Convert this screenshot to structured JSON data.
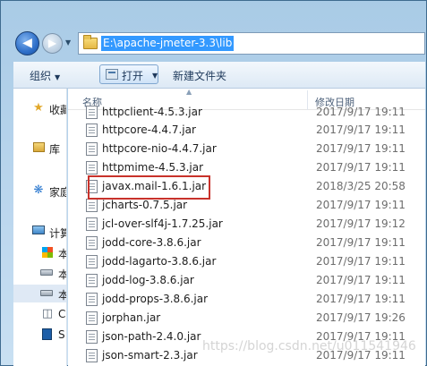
{
  "address": {
    "path": "E:\\apache-jmeter-3.3\\lib"
  },
  "toolbar": {
    "organize_label": "组织",
    "open_label": "打开",
    "new_folder_label": "新建文件夹"
  },
  "sidebar": {
    "items": [
      {
        "label": "收藏",
        "icon": "star-icon"
      },
      {
        "label": "库",
        "icon": "library-icon"
      },
      {
        "label": "家庭",
        "icon": "homegroup-icon"
      },
      {
        "label": "计算",
        "icon": "computer-icon"
      },
      {
        "label": "本",
        "icon": "drive-icon"
      },
      {
        "label": "本",
        "icon": "drive-icon"
      },
      {
        "label": "本",
        "icon": "drive-icon"
      },
      {
        "label": "C",
        "icon": "drive-icon"
      },
      {
        "label": "S",
        "icon": "drive-icon"
      }
    ]
  },
  "filelist": {
    "col_name": "名称",
    "col_date": "修改日期",
    "rows": [
      {
        "name": "httpclient-4.5.3.jar",
        "date": "2017/9/17 19:11"
      },
      {
        "name": "httpcore-4.4.7.jar",
        "date": "2017/9/17 19:11"
      },
      {
        "name": "httpcore-nio-4.4.7.jar",
        "date": "2017/9/17 19:11"
      },
      {
        "name": "httpmime-4.5.3.jar",
        "date": "2017/9/17 19:11"
      },
      {
        "name": "javax.mail-1.6.1.jar",
        "date": "2018/3/25 20:58"
      },
      {
        "name": "jcharts-0.7.5.jar",
        "date": "2017/9/17 19:11"
      },
      {
        "name": "jcl-over-slf4j-1.7.25.jar",
        "date": "2017/9/17 19:12"
      },
      {
        "name": "jodd-core-3.8.6.jar",
        "date": "2017/9/17 19:11"
      },
      {
        "name": "jodd-lagarto-3.8.6.jar",
        "date": "2017/9/17 19:11"
      },
      {
        "name": "jodd-log-3.8.6.jar",
        "date": "2017/9/17 19:11"
      },
      {
        "name": "jodd-props-3.8.6.jar",
        "date": "2017/9/17 19:11"
      },
      {
        "name": "jorphan.jar",
        "date": "2017/9/17 19:26"
      },
      {
        "name": "json-path-2.4.0.jar",
        "date": "2017/9/17 19:11"
      },
      {
        "name": "json-smart-2.3.jar",
        "date": "2017/9/17 19:11"
      }
    ]
  },
  "watermark": "https://blog.csdn.net/u011541946"
}
